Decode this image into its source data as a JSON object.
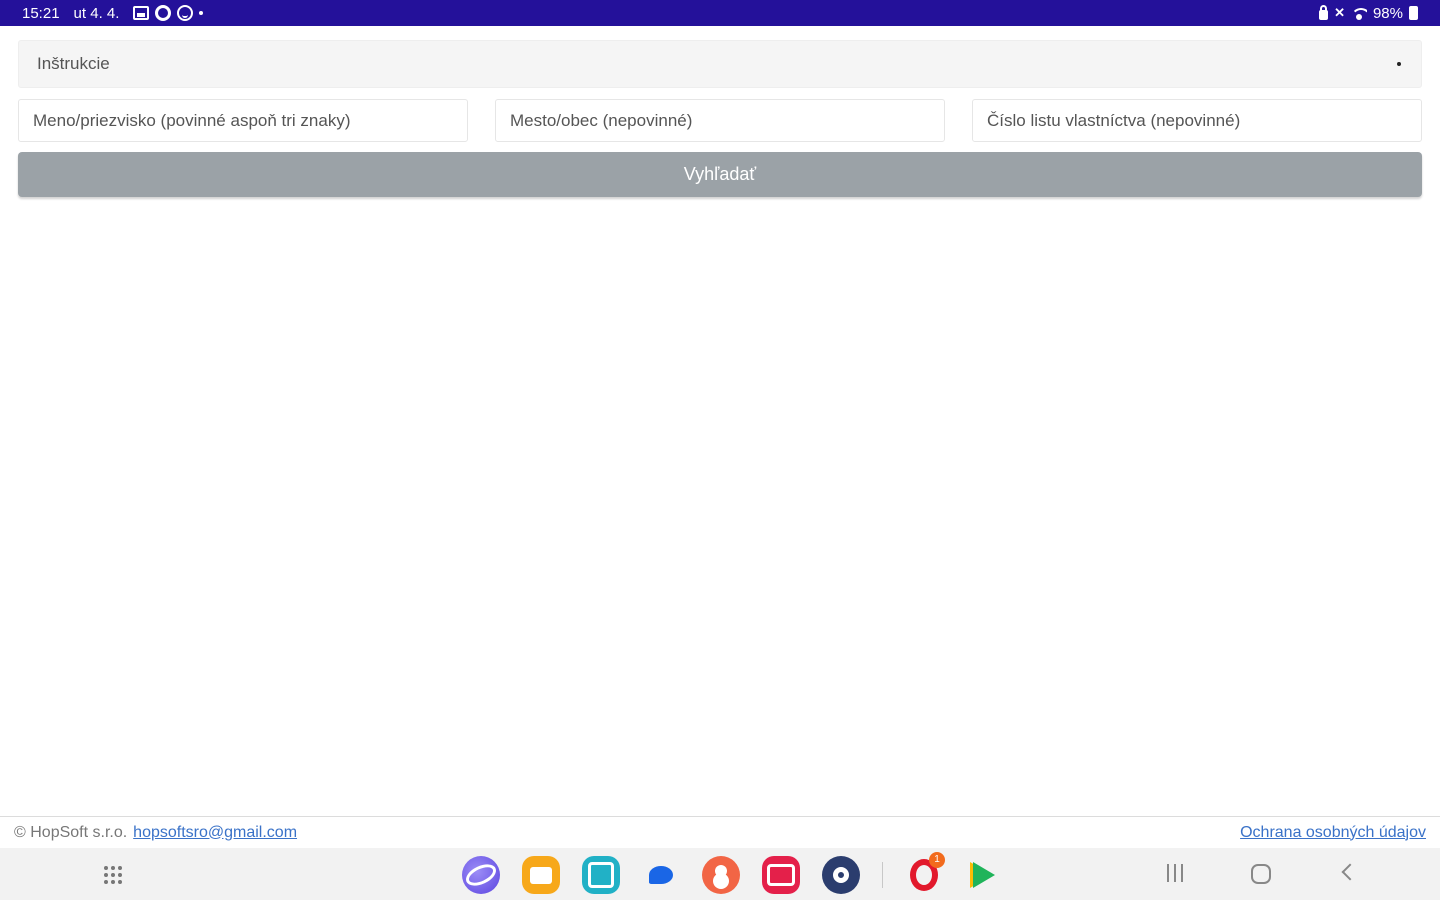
{
  "status_bar": {
    "time": "15:21",
    "date": "ut 4. 4.",
    "battery": "98%"
  },
  "instructions": {
    "label": "Inštrukcie"
  },
  "search": {
    "name_placeholder": "Meno/priezvisko (povinné aspoň tri znaky)",
    "city_placeholder": "Mesto/obec (nepovinné)",
    "sheet_placeholder": "Číslo listu vlastníctva (nepovinné)",
    "button_label": "Vyhľadať",
    "button_color": "#9ba2a7"
  },
  "footer": {
    "copyright": "© HopSoft s.r.o.",
    "email": "hopsoftsro@gmail.com",
    "privacy_link": "Ochrana osobných údajov",
    "link_color": "#3a72c8"
  },
  "dock": {
    "opera_badge": "1",
    "apps": [
      "internet-icon",
      "files-icon",
      "calendar-icon",
      "messages-icon",
      "contacts-icon",
      "video-icon",
      "settings-icon",
      "opera-icon",
      "play-store-icon"
    ]
  },
  "colors": {
    "status_bar": "#24119a"
  }
}
